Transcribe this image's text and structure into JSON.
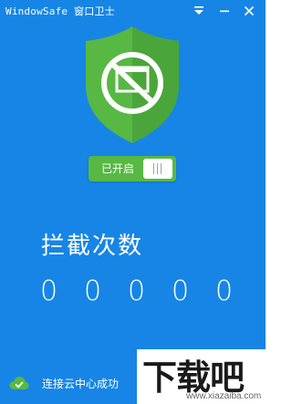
{
  "window": {
    "title": "WindowSafe 窗口卫士"
  },
  "toggle": {
    "label": "已开启"
  },
  "counter": {
    "heading": "拦截次数",
    "digits": [
      "0",
      "0",
      "0",
      "0",
      "0"
    ]
  },
  "status": {
    "text": "连接云中心成功"
  },
  "watermark": {
    "main": "下载吧",
    "sub": "www.xiazaiba.com"
  },
  "colors": {
    "background": "#1685e6",
    "shield": "#57b843",
    "toggle": "#57b843"
  }
}
